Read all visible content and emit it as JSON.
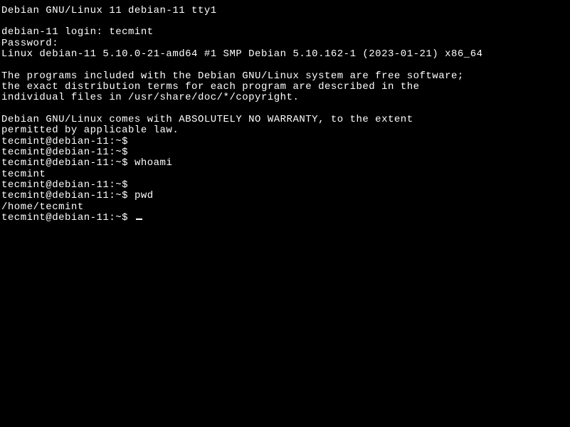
{
  "lines": {
    "l0": "Debian GNU/Linux 11 debian-11 tty1",
    "l1": "",
    "l2_prompt": "debian-11 login: ",
    "l2_input": "tecmint",
    "l3": "Password:",
    "l4": "Linux debian-11 5.10.0-21-amd64 #1 SMP Debian 5.10.162-1 (2023-01-21) x86_64",
    "l5": "",
    "l6": "The programs included with the Debian GNU/Linux system are free software;",
    "l7": "the exact distribution terms for each program are described in the",
    "l8": "individual files in /usr/share/doc/*/copyright.",
    "l9": "",
    "l10": "Debian GNU/Linux comes with ABSOLUTELY NO WARRANTY, to the extent",
    "l11": "permitted by applicable law.",
    "l12_prompt": "tecmint@debian-11:~$ ",
    "l12_input": "",
    "l13_prompt": "tecmint@debian-11:~$ ",
    "l13_input": "",
    "l14_prompt": "tecmint@debian-11:~$ ",
    "l14_input": "whoami",
    "l15": "tecmint",
    "l16_prompt": "tecmint@debian-11:~$ ",
    "l16_input": "",
    "l17_prompt": "tecmint@debian-11:~$ ",
    "l17_input": "pwd",
    "l18": "/home/tecmint",
    "l19_prompt": "tecmint@debian-11:~$ ",
    "l19_input": ""
  }
}
